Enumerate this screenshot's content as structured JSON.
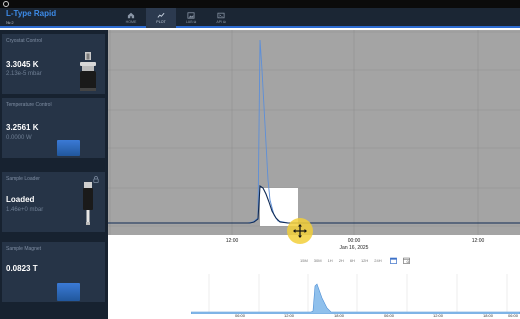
{
  "app": {
    "title": "L-Type Rapid",
    "subtitle": "№ 2"
  },
  "tabs": [
    {
      "label": "HOME",
      "icon": "home-icon",
      "active": false
    },
    {
      "label": "PLOT",
      "icon": "chart-icon",
      "active": true
    },
    {
      "label": "LAB ⧉",
      "icon": "image-icon",
      "active": false
    },
    {
      "label": "API ⧉",
      "icon": "api-icon",
      "active": false
    }
  ],
  "cards": [
    {
      "title": "Cryostat Control",
      "value": "3.3045 K",
      "sub": "2.13e-5 mbar"
    },
    {
      "title": "Temperature Control",
      "value": "3.2561 K",
      "sub": "0.0000 W"
    },
    {
      "title": "Sample Loader",
      "value": "Loaded",
      "sub": "1.46e+0 mbar"
    },
    {
      "title": "Sample Magnet",
      "value": "0.0823 T",
      "sub": ""
    }
  ],
  "plot": {
    "x_ticks": [
      "12:00",
      "00:00",
      "12:00"
    ],
    "date_label": "Jan 16, 2025",
    "ranges": [
      "15M",
      "30M",
      "1H",
      "2H",
      "6H",
      "12H",
      "24H"
    ],
    "nav_ticks": [
      "06:00",
      "12:00",
      "18:00",
      "06:00",
      "12:00",
      "18:00",
      "06:00"
    ]
  },
  "colors": {
    "accent": "#2d6cd2",
    "title_blue": "#3d8be8",
    "sidebar_bg": "#172230",
    "card_bg": "#263447",
    "plot_bg": "#a4a4a4",
    "selection": "#f2cf3a"
  }
}
